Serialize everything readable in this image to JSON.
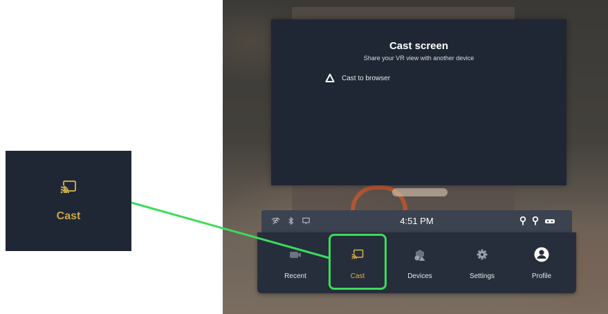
{
  "zoom_inset": {
    "label": "Cast",
    "icon": "cast-icon"
  },
  "cast_panel": {
    "title": "Cast screen",
    "subtitle": "Share your VR view with another device",
    "option_label": "Cast to browser",
    "option_icon": "browser-icon"
  },
  "status_bar": {
    "time": "4:51 PM",
    "left_icons": [
      "wifi-icon",
      "bluetooth-icon",
      "display-icon"
    ],
    "right_icons": [
      "controller-left-icon",
      "controller-right-icon",
      "headset-icon"
    ]
  },
  "nav": {
    "items": [
      {
        "label": "Recent",
        "icon": "recent-icon",
        "active": false
      },
      {
        "label": "Cast",
        "icon": "cast-icon",
        "active": true
      },
      {
        "label": "Devices",
        "icon": "devices-icon",
        "active": false
      },
      {
        "label": "Settings",
        "icon": "gear-icon",
        "active": false
      },
      {
        "label": "Profile",
        "icon": "profile-icon",
        "active": false
      }
    ]
  },
  "colors": {
    "accent_gold": "#d9b24a",
    "highlight_green": "#3cdc5a",
    "panel_bg": "#1f2734",
    "dock_bg": "#262e3b"
  }
}
